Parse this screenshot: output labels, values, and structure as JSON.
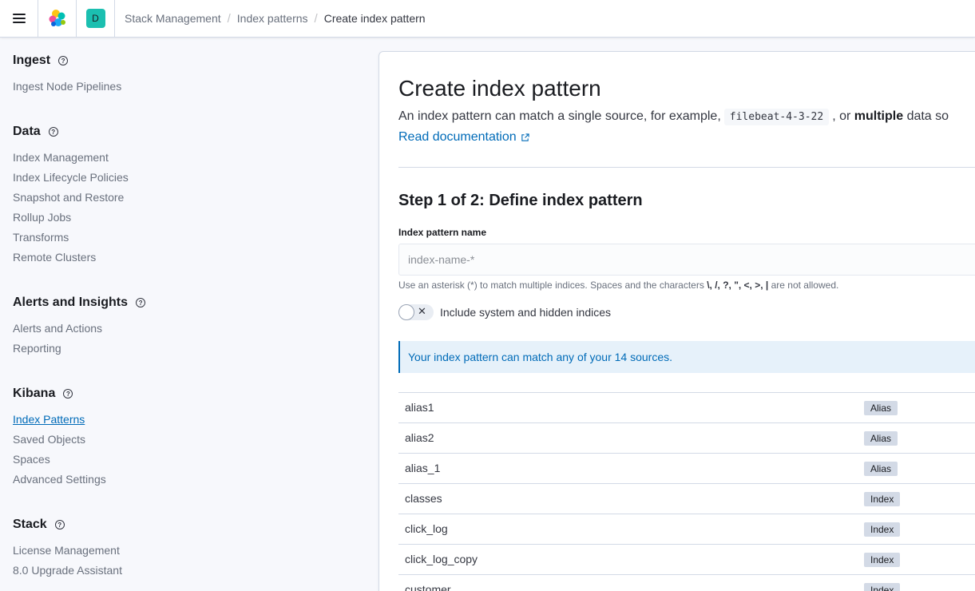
{
  "header": {
    "space_initial": "D",
    "breadcrumbs": [
      "Stack Management",
      "Index patterns",
      "Create index pattern"
    ]
  },
  "sidebar": {
    "groups": [
      {
        "title": "Ingest",
        "items": [
          "Ingest Node Pipelines"
        ]
      },
      {
        "title": "Data",
        "items": [
          "Index Management",
          "Index Lifecycle Policies",
          "Snapshot and Restore",
          "Rollup Jobs",
          "Transforms",
          "Remote Clusters"
        ]
      },
      {
        "title": "Alerts and Insights",
        "items": [
          "Alerts and Actions",
          "Reporting"
        ]
      },
      {
        "title": "Kibana",
        "items": [
          "Index Patterns",
          "Saved Objects",
          "Spaces",
          "Advanced Settings"
        ]
      },
      {
        "title": "Stack",
        "items": [
          "License Management",
          "8.0 Upgrade Assistant"
        ]
      }
    ],
    "active_item": "Index Patterns"
  },
  "main": {
    "title": "Create index pattern",
    "description_start": "An index pattern can match a single source, for example,",
    "description_code": "filebeat-4-3-22",
    "description_mid": ", or",
    "description_bold": "multiple",
    "description_end": "data so",
    "doc_link": "Read documentation",
    "step_title": "Step 1 of 2: Define index pattern",
    "field_label": "Index pattern name",
    "field_placeholder": "index-name-*",
    "field_value": "",
    "help_text_start": "Use an asterisk (*) to match multiple indices. Spaces and the characters",
    "help_chars": "\\, /, ?, \", <, >, |",
    "help_text_end": "are not allowed.",
    "toggle_label": "Include system and hidden indices",
    "toggle_on": false,
    "callout": "Your index pattern can match any of your 14 sources.",
    "sources": [
      {
        "name": "alias1",
        "type": "Alias"
      },
      {
        "name": "alias2",
        "type": "Alias"
      },
      {
        "name": "alias_1",
        "type": "Alias"
      },
      {
        "name": "classes",
        "type": "Index"
      },
      {
        "name": "click_log",
        "type": "Index"
      },
      {
        "name": "click_log_copy",
        "type": "Index"
      },
      {
        "name": "customer",
        "type": "Index"
      }
    ]
  },
  "icons": {
    "menu": "hamburger-icon",
    "logo": "elastic-logo-icon",
    "help": "question-circle-icon",
    "external": "popout-icon",
    "toggle_off": "cross-icon"
  }
}
